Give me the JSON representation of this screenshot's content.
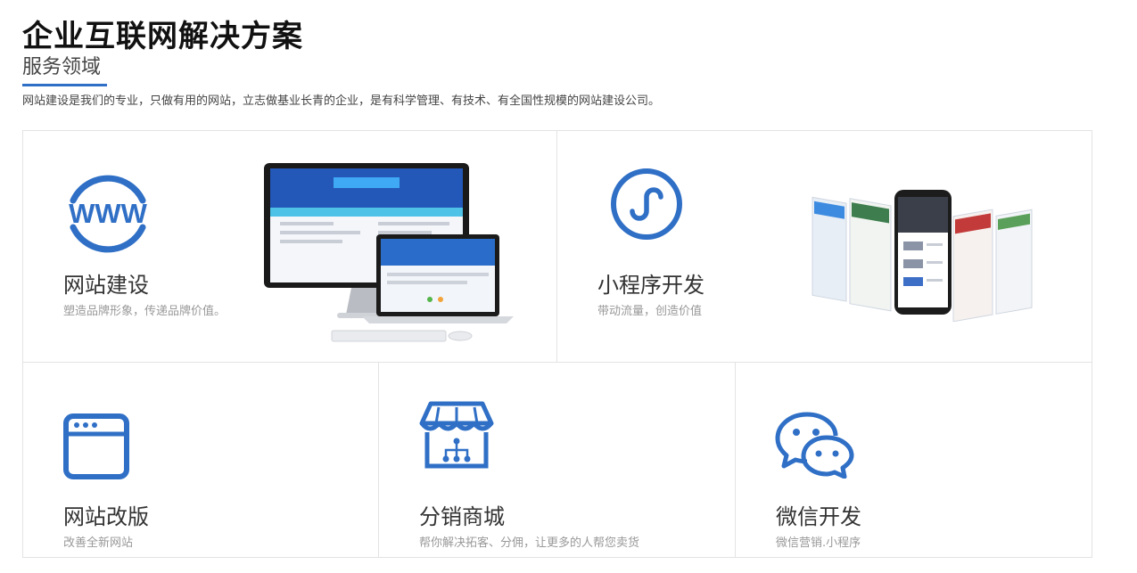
{
  "header": {
    "title": "企业互联网解决方案",
    "subtitle": "服务领域",
    "intro": "网站建设是我们的专业，只做有用的网站，立志做基业长青的企业，是有科学管理、有技术、有全国性规模的网站建设公司。"
  },
  "accent_color": "#2f6fc6",
  "services": [
    {
      "title": "网站建设",
      "desc": "塑造品牌形象，传递品牌价值。",
      "icon": "www-globe-icon"
    },
    {
      "title": "小程序开发",
      "desc": "带动流量，创造价值",
      "icon": "mini-program-icon"
    },
    {
      "title": "网站改版",
      "desc": "改善全新网站",
      "icon": "browser-window-icon"
    },
    {
      "title": "分销商城",
      "desc": "帮你解决拓客、分佣，让更多的人帮您卖货",
      "icon": "storefront-icon"
    },
    {
      "title": "微信开发",
      "desc": "微信营销.小程序",
      "icon": "wechat-icon"
    }
  ]
}
